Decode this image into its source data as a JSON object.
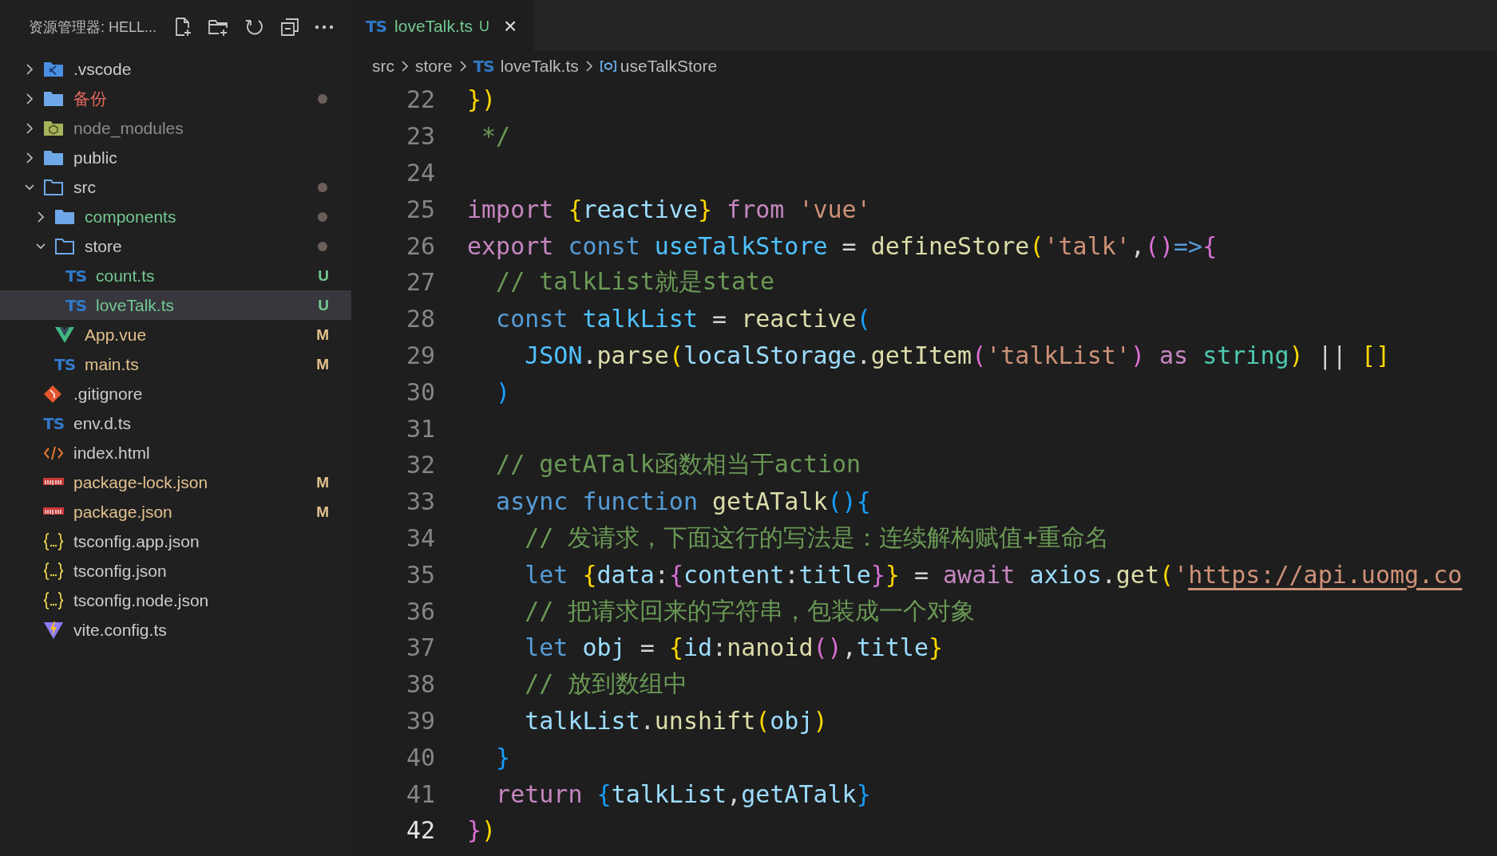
{
  "explorer": {
    "title": "资源管理器: HELL...",
    "tree": [
      {
        "name": ".vscode",
        "kind": "vscode-folder",
        "expanded": false,
        "selected": false,
        "dot": false,
        "color": "#cccccc"
      },
      {
        "name": "备份",
        "kind": "folder",
        "expanded": false,
        "selected": false,
        "dot": true,
        "color": "#e0665c"
      },
      {
        "name": "node_modules",
        "kind": "node-folder",
        "expanded": false,
        "selected": false,
        "dot": false,
        "color": "#8c8c8c"
      },
      {
        "name": "public",
        "kind": "folder",
        "expanded": false,
        "selected": false,
        "dot": false,
        "color": "#cccccc"
      },
      {
        "name": "src",
        "kind": "folder",
        "expanded": true,
        "selected": false,
        "dot": true,
        "color": "#cccccc",
        "children": [
          {
            "name": "components",
            "kind": "folder",
            "expanded": false,
            "selected": false,
            "dot": true,
            "color": "#73c991"
          },
          {
            "name": "store",
            "kind": "folder",
            "expanded": true,
            "selected": false,
            "dot": true,
            "color": "#cccccc",
            "children": [
              {
                "name": "count.ts",
                "kind": "ts",
                "icon_text": "TS",
                "badge": "U",
                "selected": false,
                "dot": false,
                "color": "#73c991"
              },
              {
                "name": "loveTalk.ts",
                "kind": "ts",
                "icon_text": "TS",
                "badge": "U",
                "selected": true,
                "dot": false,
                "color": "#73c991"
              }
            ]
          },
          {
            "name": "App.vue",
            "kind": "vue",
            "badge": "M",
            "selected": false,
            "dot": false,
            "color": "#e2c08d"
          },
          {
            "name": "main.ts",
            "kind": "ts",
            "icon_text": "TS",
            "badge": "M",
            "selected": false,
            "dot": false,
            "color": "#e2c08d"
          }
        ]
      },
      {
        "name": ".gitignore",
        "kind": "git",
        "selected": false,
        "dot": false,
        "color": "#cccccc"
      },
      {
        "name": "env.d.ts",
        "kind": "ts",
        "icon_text": "TS",
        "selected": false,
        "dot": false,
        "color": "#cccccc"
      },
      {
        "name": "index.html",
        "kind": "html",
        "selected": false,
        "dot": false,
        "color": "#cccccc"
      },
      {
        "name": "package-lock.json",
        "kind": "npm",
        "badge": "M",
        "selected": false,
        "dot": false,
        "color": "#e2c08d"
      },
      {
        "name": "package.json",
        "kind": "npm",
        "badge": "M",
        "selected": false,
        "dot": false,
        "color": "#e2c08d"
      },
      {
        "name": "tsconfig.app.json",
        "kind": "json",
        "selected": false,
        "dot": false,
        "color": "#cccccc"
      },
      {
        "name": "tsconfig.json",
        "kind": "json",
        "selected": false,
        "dot": false,
        "color": "#cccccc"
      },
      {
        "name": "tsconfig.node.json",
        "kind": "json",
        "selected": false,
        "dot": false,
        "color": "#cccccc"
      },
      {
        "name": "vite.config.ts",
        "kind": "vite",
        "selected": false,
        "dot": false,
        "color": "#cccccc"
      }
    ]
  },
  "tabs": [
    {
      "icon_text": "TS",
      "label": "loveTalk.ts",
      "badge": "U",
      "close": "×",
      "selected": true
    }
  ],
  "breadcrumbs": [
    {
      "kind": "folder",
      "label": "src"
    },
    {
      "kind": "folder",
      "label": "store"
    },
    {
      "kind": "file",
      "icon_text": "TS",
      "label": "loveTalk.ts"
    },
    {
      "kind": "symbol",
      "label": "useTalkStore"
    }
  ],
  "code": [
    {
      "number": "22",
      "current": false,
      "tokens": [
        {
          "text": "}",
          "kind": "b1"
        },
        {
          "text": ")",
          "kind": "b1"
        }
      ]
    },
    {
      "number": "23",
      "current": false,
      "tokens": [
        {
          "text": " */",
          "kind": "comment"
        }
      ]
    },
    {
      "number": "24",
      "current": false
    },
    {
      "number": "25",
      "current": false,
      "tokens": [
        {
          "text": "import",
          "kind": "control"
        },
        {
          "text": " {",
          "kind": "b1"
        },
        {
          "text": "reactive",
          "kind": "var"
        },
        {
          "text": "}",
          "kind": "b1"
        },
        {
          "text": " from",
          "kind": "control"
        },
        {
          "text": " 'vue'",
          "kind": "string"
        }
      ]
    },
    {
      "number": "26",
      "current": false,
      "tokens": [
        {
          "text": "export",
          "kind": "control"
        },
        {
          "text": " const",
          "kind": "keyword"
        },
        {
          "text": " useTalkStore",
          "kind": "const"
        },
        {
          "text": " = ",
          "kind": "plain"
        },
        {
          "text": "defineStore",
          "kind": "function"
        },
        {
          "text": "(",
          "kind": "b1"
        },
        {
          "text": "'talk'",
          "kind": "string"
        },
        {
          "text": ",",
          "kind": "plain"
        },
        {
          "text": "()",
          "kind": "b2"
        },
        {
          "text": "=>",
          "kind": "keyword"
        },
        {
          "text": "{",
          "kind": "b2"
        }
      ]
    },
    {
      "number": "27",
      "current": false,
      "tokens": [
        {
          "text": "  // talkList就是state",
          "kind": "comment"
        }
      ]
    },
    {
      "number": "28",
      "current": false,
      "tokens": [
        {
          "text": "  const",
          "kind": "keyword"
        },
        {
          "text": " talkList",
          "kind": "const"
        },
        {
          "text": " = ",
          "kind": "plain"
        },
        {
          "text": "reactive",
          "kind": "function"
        },
        {
          "text": "(",
          "kind": "b3"
        }
      ]
    },
    {
      "number": "29",
      "current": false,
      "tokens": [
        {
          "text": "    JSON",
          "kind": "const"
        },
        {
          "text": ".",
          "kind": "plain"
        },
        {
          "text": "parse",
          "kind": "function"
        },
        {
          "text": "(",
          "kind": "b1"
        },
        {
          "text": "localStorage",
          "kind": "var"
        },
        {
          "text": ".",
          "kind": "plain"
        },
        {
          "text": "getItem",
          "kind": "function"
        },
        {
          "text": "(",
          "kind": "b2"
        },
        {
          "text": "'talkList'",
          "kind": "string"
        },
        {
          "text": ")",
          "kind": "b2"
        },
        {
          "text": " as",
          "kind": "control"
        },
        {
          "text": " string",
          "kind": "type"
        },
        {
          "text": ")",
          "kind": "b1"
        },
        {
          "text": " || ",
          "kind": "plain"
        },
        {
          "text": "[]",
          "kind": "b1"
        }
      ]
    },
    {
      "number": "30",
      "current": false,
      "tokens": [
        {
          "text": "  )",
          "kind": "b3"
        }
      ]
    },
    {
      "number": "31",
      "current": false
    },
    {
      "number": "32",
      "current": false,
      "tokens": [
        {
          "text": "  // getATalk函数相当于action",
          "kind": "comment"
        }
      ]
    },
    {
      "number": "33",
      "current": false,
      "tokens": [
        {
          "text": "  async",
          "kind": "keyword"
        },
        {
          "text": " function",
          "kind": "keyword"
        },
        {
          "text": " getATalk",
          "kind": "function"
        },
        {
          "text": "(){",
          "kind": "b3"
        }
      ]
    },
    {
      "number": "34",
      "current": false,
      "tokens": [
        {
          "text": "    // 发请求，下面这行的写法是：连续解构赋值+重命名",
          "kind": "comment"
        }
      ]
    },
    {
      "number": "35",
      "current": false,
      "tokens": [
        {
          "text": "    let",
          "kind": "keyword"
        },
        {
          "text": " {",
          "kind": "b1"
        },
        {
          "text": "data",
          "kind": "var"
        },
        {
          "text": ":",
          "kind": "plain"
        },
        {
          "text": "{",
          "kind": "b2"
        },
        {
          "text": "content",
          "kind": "var"
        },
        {
          "text": ":",
          "kind": "plain"
        },
        {
          "text": "title",
          "kind": "var"
        },
        {
          "text": "}",
          "kind": "b2"
        },
        {
          "text": "}",
          "kind": "b1"
        },
        {
          "text": " = ",
          "kind": "plain"
        },
        {
          "text": "await",
          "kind": "control"
        },
        {
          "text": " axios",
          "kind": "var"
        },
        {
          "text": ".",
          "kind": "plain"
        },
        {
          "text": "get",
          "kind": "function"
        },
        {
          "text": "(",
          "kind": "b1"
        },
        {
          "text": "'",
          "kind": "string"
        },
        {
          "text": "https://api.uomg.co",
          "kind": "link"
        }
      ]
    },
    {
      "number": "36",
      "current": false,
      "tokens": [
        {
          "text": "    // 把请求回来的字符串，包装成一个对象",
          "kind": "comment"
        }
      ]
    },
    {
      "number": "37",
      "current": false,
      "tokens": [
        {
          "text": "    let",
          "kind": "keyword"
        },
        {
          "text": " obj",
          "kind": "var"
        },
        {
          "text": " = ",
          "kind": "plain"
        },
        {
          "text": "{",
          "kind": "b1"
        },
        {
          "text": "id",
          "kind": "var"
        },
        {
          "text": ":",
          "kind": "plain"
        },
        {
          "text": "nanoid",
          "kind": "function"
        },
        {
          "text": "()",
          "kind": "b2"
        },
        {
          "text": ",",
          "kind": "plain"
        },
        {
          "text": "title",
          "kind": "var"
        },
        {
          "text": "}",
          "kind": "b1"
        }
      ]
    },
    {
      "number": "38",
      "current": false,
      "tokens": [
        {
          "text": "    // 放到数组中",
          "kind": "comment"
        }
      ]
    },
    {
      "number": "39",
      "current": false,
      "tokens": [
        {
          "text": "    talkList",
          "kind": "var"
        },
        {
          "text": ".",
          "kind": "plain"
        },
        {
          "text": "unshift",
          "kind": "function"
        },
        {
          "text": "(",
          "kind": "b1"
        },
        {
          "text": "obj",
          "kind": "var"
        },
        {
          "text": ")",
          "kind": "b1"
        }
      ]
    },
    {
      "number": "40",
      "current": false,
      "tokens": [
        {
          "text": "  }",
          "kind": "b3"
        }
      ]
    },
    {
      "number": "41",
      "current": false,
      "tokens": [
        {
          "text": "  return",
          "kind": "control"
        },
        {
          "text": " {",
          "kind": "b3"
        },
        {
          "text": "talkList",
          "kind": "var"
        },
        {
          "text": ",",
          "kind": "plain"
        },
        {
          "text": "getATalk",
          "kind": "var"
        },
        {
          "text": "}",
          "kind": "b3"
        }
      ]
    },
    {
      "number": "42",
      "current": true,
      "tokens": [
        {
          "text": "}",
          "kind": "b2"
        },
        {
          "text": ")",
          "kind": "b1"
        }
      ]
    }
  ]
}
